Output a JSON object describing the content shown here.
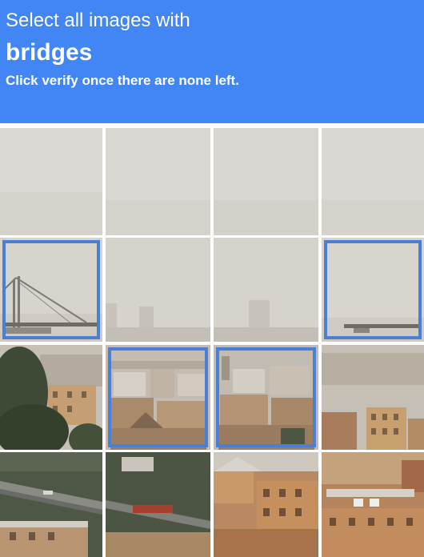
{
  "header": {
    "line1": "Select all images with",
    "target_word": "bridges",
    "instruction": "Click verify once there are none left."
  },
  "colors": {
    "header_bg": "#4285f4",
    "selection_border": "#4a7fd6",
    "haze": "#d9d6d1"
  },
  "grid": {
    "rows": 4,
    "cols": 4,
    "tiles": [
      {
        "id": "r1c1",
        "content": "hazy-sky",
        "selected": false
      },
      {
        "id": "r1c2",
        "content": "hazy-sky",
        "selected": false
      },
      {
        "id": "r1c3",
        "content": "hazy-sky",
        "selected": false
      },
      {
        "id": "r1c4",
        "content": "hazy-sky",
        "selected": false
      },
      {
        "id": "r2c1",
        "content": "bridge-pylon",
        "selected": true
      },
      {
        "id": "r2c2",
        "content": "hazy-skyline",
        "selected": false
      },
      {
        "id": "r2c3",
        "content": "hazy-skyline",
        "selected": false
      },
      {
        "id": "r2c4",
        "content": "bridge-deck-fragment",
        "selected": true
      },
      {
        "id": "r3c1",
        "content": "trees-and-buildings",
        "selected": false
      },
      {
        "id": "r3c2",
        "content": "rooftops",
        "selected": true
      },
      {
        "id": "r3c3",
        "content": "rooftops",
        "selected": true
      },
      {
        "id": "r3c4",
        "content": "city-buildings",
        "selected": false
      },
      {
        "id": "r4c1",
        "content": "viaduct-road",
        "selected": false
      },
      {
        "id": "r4c2",
        "content": "viaduct-road",
        "selected": false
      },
      {
        "id": "r4c3",
        "content": "orange-buildings",
        "selected": false
      },
      {
        "id": "r4c4",
        "content": "orange-buildings",
        "selected": false
      }
    ]
  }
}
